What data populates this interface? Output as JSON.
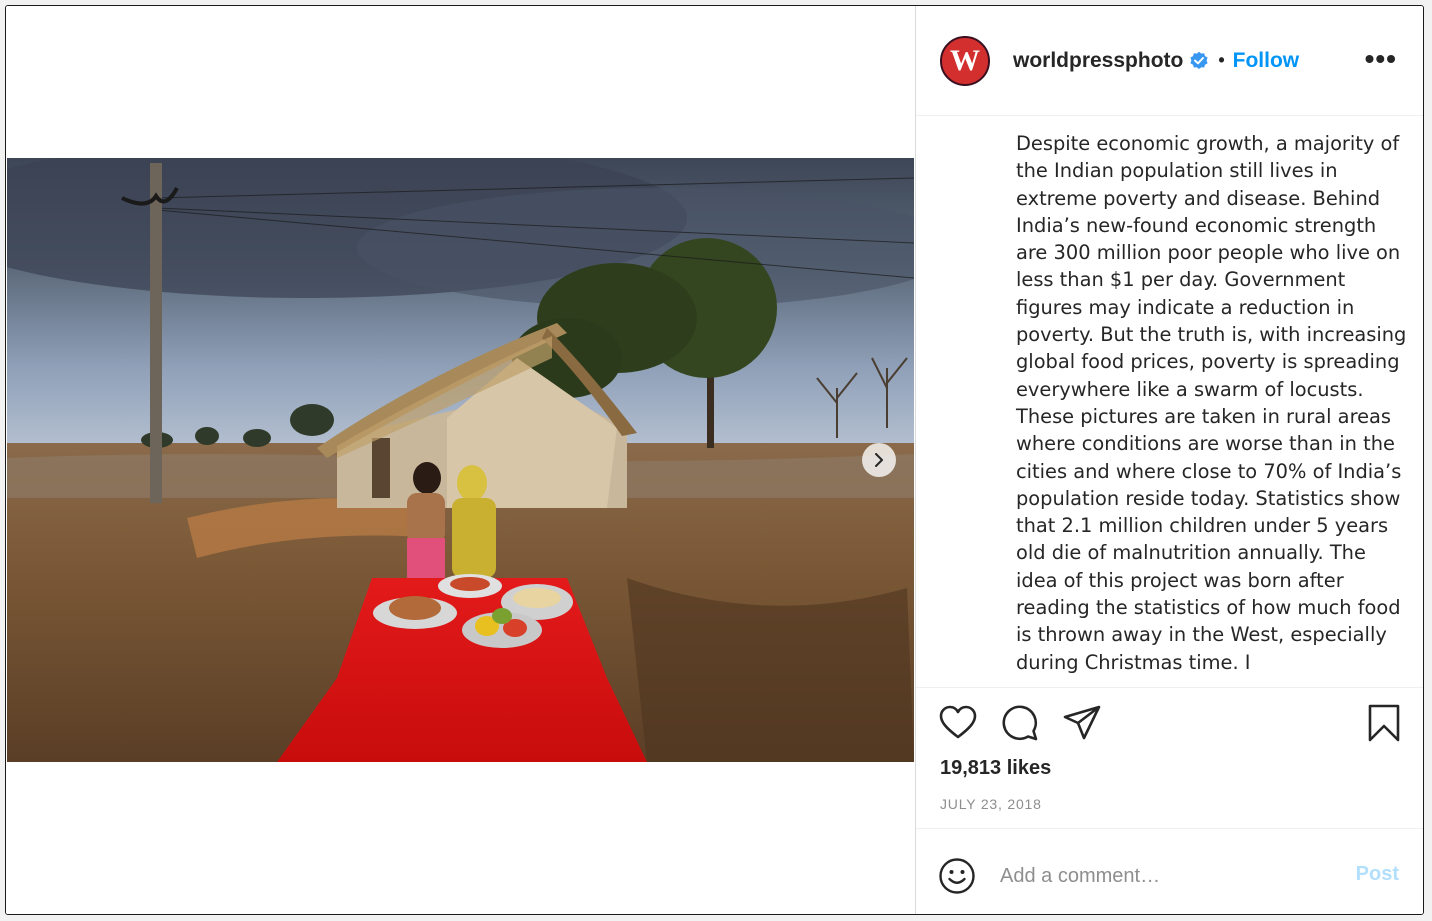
{
  "post": {
    "username": "worldpressphoto",
    "avatar_letter": "W",
    "follow_label": "Follow",
    "separator": "•",
    "more_label": "•••",
    "caption": "Despite economic growth, a majority of the Indian population still lives in extreme poverty and disease. Behind India’s new-found economic strength are 300 million poor people who live on less than $1 per day. Government figures may indicate a reduction in poverty. But the truth is, with increasing global food prices, poverty is spreading everywhere like a swarm of locusts. These pictures are taken in rural areas where conditions are worse than in the cities and where close to 70% of India’s population reside today. Statistics show that 2.1 million children under 5 years old die of malnutrition annually. The idea of this project was born after reading the statistics of how much food is thrown away in the West, especially during Christmas time. I",
    "likes": "19,813 likes",
    "date": "JULY 23, 2018"
  },
  "comment": {
    "placeholder": "Add a comment…",
    "post_label": "Post"
  },
  "icons": {
    "verified": "verified-badge-icon",
    "next": "chevron-right-icon",
    "like": "heart-icon",
    "comment": "comment-bubble-icon",
    "share": "paper-plane-icon",
    "save": "bookmark-icon",
    "emoji": "smiley-icon"
  },
  "colors": {
    "accent": "#0095f6",
    "post_disabled": "#b2dffc",
    "avatar_bg": "#d32f2f",
    "verified": "#3897f0"
  }
}
